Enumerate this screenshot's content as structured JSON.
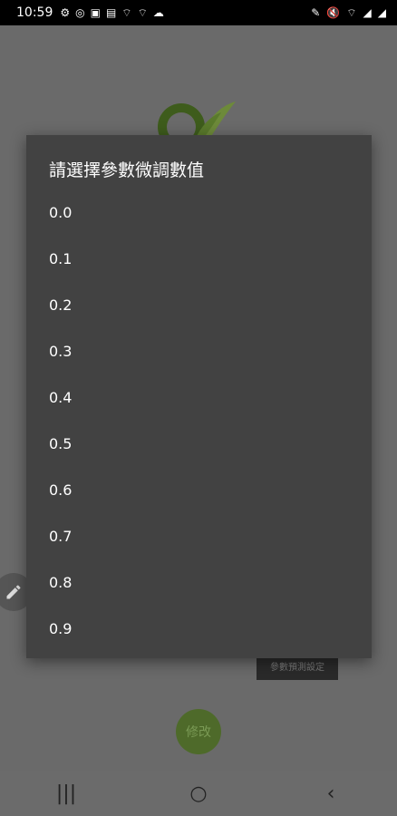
{
  "status": {
    "time": "10:59",
    "left_icons": [
      "⚙",
      "◎",
      "▣",
      "▤",
      "⌔",
      "⌔",
      "☁"
    ],
    "right_icons": [
      "✎",
      "🔇",
      "⌔",
      "◢",
      "◢"
    ]
  },
  "dialog": {
    "title": "請選擇參數微調數值",
    "options": [
      "0.0",
      "0.1",
      "0.2",
      "0.3",
      "0.4",
      "0.5",
      "0.6",
      "0.7",
      "0.8",
      "0.9"
    ]
  },
  "background": {
    "param_button_label": "參數預測設定",
    "modify_label": "修改"
  },
  "nav": {
    "recents": "|||",
    "home": "○",
    "back": "‹"
  }
}
